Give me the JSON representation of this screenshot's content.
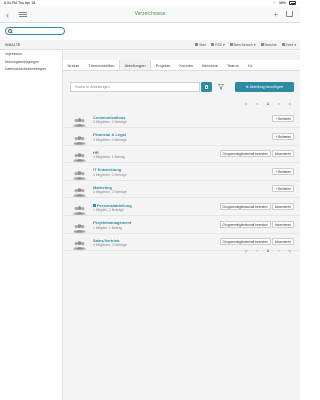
{
  "status": {
    "time": "8:34 PM",
    "date": "Thu Apr 18",
    "battery": "58%"
  },
  "header": {
    "title": "Verzeichnisse"
  },
  "sidebar_search": {
    "placeholder": ""
  },
  "toolbar": {
    "section_label": "INHALTE",
    "actions": [
      {
        "label": "Start"
      },
      {
        "label": "RSS"
      },
      {
        "label": "Mein Bereich"
      },
      {
        "label": "Berichte"
      },
      {
        "label": "Extra"
      }
    ]
  },
  "sidebar": {
    "items": [
      "Impressum",
      "Nutzungsbedingungen",
      "Datenschutzbestimmungen"
    ]
  },
  "tabs": [
    "Nutzer",
    "Themenwelten",
    "Abteilungen",
    "Projekte",
    "Kunden",
    "Bereiche",
    "Teams",
    "Gr"
  ],
  "active_tab": "Abteilungen",
  "content_search": {
    "placeholder": "Suche in Abteilungen"
  },
  "add_button": "Abteilung hinzufügen",
  "pager": {
    "first": "|<",
    "prev": "<",
    "page": "1",
    "next": ">",
    "last": ">|"
  },
  "rows": [
    {
      "name": "Communications",
      "meta": "3 Mitglieder, 0 Beiträge",
      "locked": false,
      "buttons": [
        "+ Beitreten"
      ]
    },
    {
      "name": "Financial & Legal",
      "meta": "3 Mitglieder, 0 Beiträge",
      "locked": false,
      "buttons": [
        "+ Beitreten"
      ]
    },
    {
      "name": "HR",
      "meta": "3 Mitglieder, 1 Beitrag",
      "locked": false,
      "buttons": [
        "Gruppenmitgliedschaft beenden",
        "Abonnieren"
      ]
    },
    {
      "name": "IT Entwicklung",
      "meta": "3 Mitglieder, 0 Beiträge",
      "locked": false,
      "buttons": [
        "+ Beitreten"
      ]
    },
    {
      "name": "Marketing",
      "meta": "4 Mitglieder, 0 Beiträge",
      "locked": false,
      "buttons": [
        "+ Beitreten"
      ]
    },
    {
      "name": "Personalabteilung",
      "meta": "1 Mitglied, 2 Beiträge",
      "locked": true,
      "buttons": [
        "Gruppenmitgliedschaft beenden",
        "Abonnieren"
      ]
    },
    {
      "name": "Projektmanagement",
      "meta": "1 Mitglied, 1 Beitrag",
      "locked": false,
      "buttons": [
        "Gruppenmitgliedschaft beenden",
        "Abonnieren"
      ]
    },
    {
      "name": "Sales/Vertrieb",
      "meta": "4 Mitglieder, 0 Beiträge",
      "locked": false,
      "buttons": [
        "Gruppenmitgliedschaft beenden",
        "Abonnieren"
      ]
    }
  ]
}
